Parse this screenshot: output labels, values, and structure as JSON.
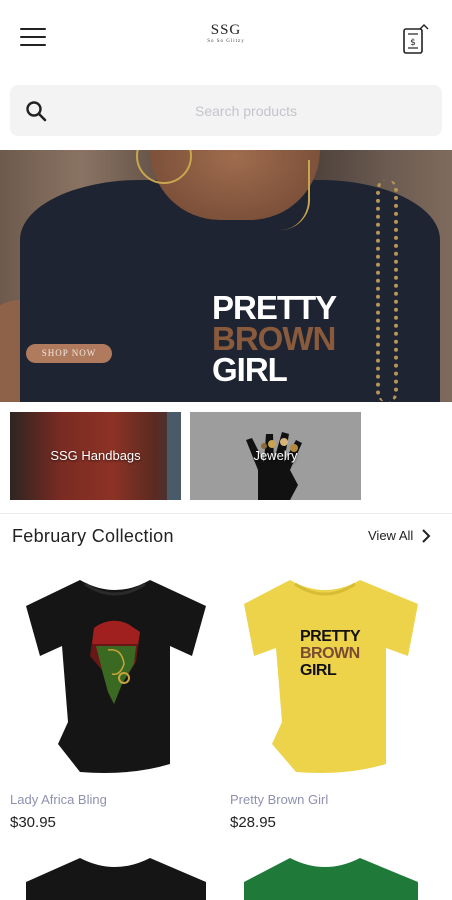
{
  "header": {
    "logo_main": "SSG",
    "logo_sub": "So So Glitzy"
  },
  "search": {
    "placeholder": "Search products"
  },
  "hero": {
    "line1": "PRETTY",
    "line2": "BROWN",
    "line3": "GIRL",
    "cta": "SHOP NOW"
  },
  "categories": [
    {
      "label": "SSG Handbags"
    },
    {
      "label": "Jewelry"
    }
  ],
  "section": {
    "title": "February Collection",
    "view_all": "View All"
  },
  "products": [
    {
      "name": "Lady Africa Bling",
      "price": "$30.95",
      "shirt_color": "#151515"
    },
    {
      "name": "Pretty Brown Girl",
      "price": "$28.95",
      "shirt_color": "#ecd34a",
      "print": {
        "line1": "PRETTY",
        "line2": "BROWN",
        "line3": "GIRL"
      }
    },
    {
      "shirt_color": "#151515"
    },
    {
      "shirt_color": "#1f7a3a"
    }
  ],
  "colors": {
    "hero_accent": "#8a5a3c",
    "product_name": "#8f90b0",
    "search_bg": "#f3f3f3"
  }
}
